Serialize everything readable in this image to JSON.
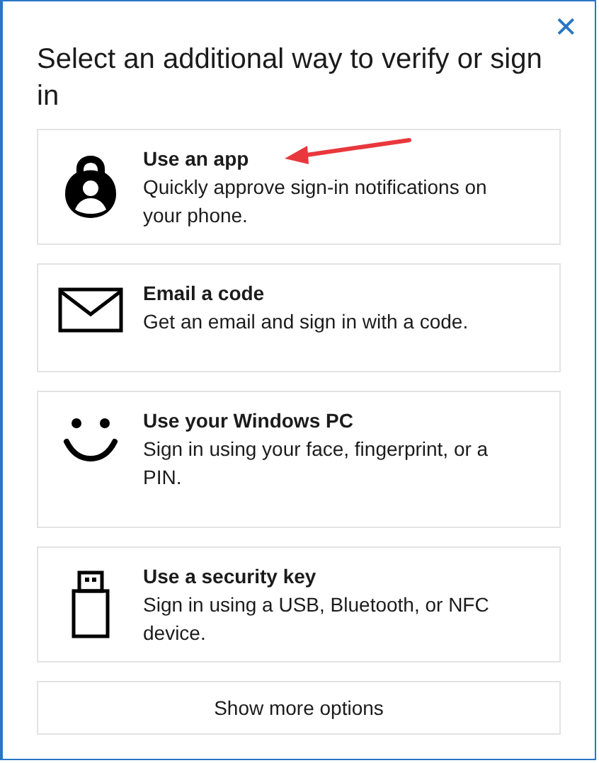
{
  "dialog": {
    "close_button": "✕",
    "title": "Select an additional way to verify or sign in"
  },
  "options": [
    {
      "kind": "app",
      "title": "Use an app",
      "description": "Quickly approve sign-in notifications on your phone."
    },
    {
      "kind": "email",
      "title": "Email a code",
      "description": "Get an email and sign in with a code."
    },
    {
      "kind": "face",
      "title": "Use your Windows PC",
      "description": "Sign in using your face, fingerprint, or a PIN."
    },
    {
      "kind": "key",
      "title": "Use a security key",
      "description": "Sign in using a USB, Bluetooth, or NFC device."
    }
  ],
  "more_button": "Show more options"
}
